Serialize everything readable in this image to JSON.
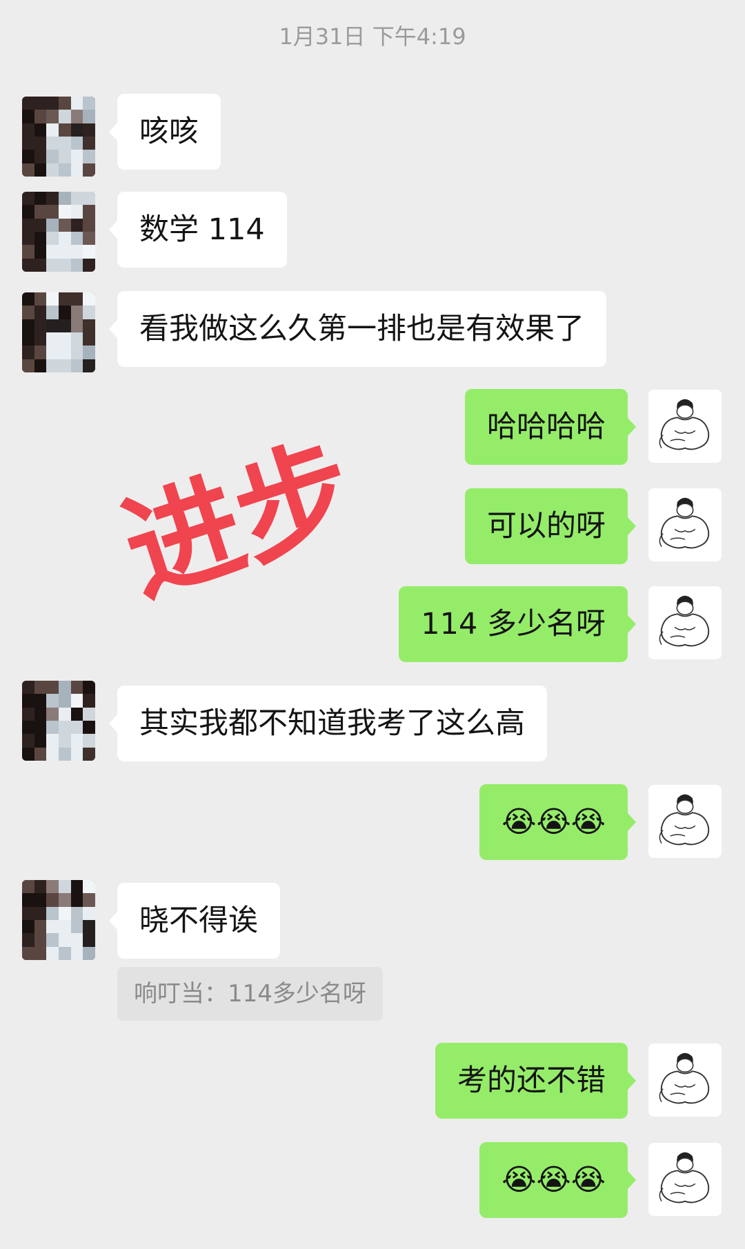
{
  "chat": {
    "timestamp": "1月31日 下午4:19",
    "messages": [
      {
        "side": "in",
        "text": "咳咳"
      },
      {
        "side": "in",
        "text": "数学 114"
      },
      {
        "side": "in",
        "text": "看我做这么久第一排也是有效果了"
      },
      {
        "side": "out",
        "text": "哈哈哈哈"
      },
      {
        "side": "out",
        "text": "可以的呀"
      },
      {
        "side": "out",
        "text": "114 多少名呀"
      },
      {
        "side": "in",
        "text": "其实我都不知道我考了这么高"
      },
      {
        "side": "out",
        "emoji": "😭😭😭",
        "emoji_name": "facepalm-laughing-emoji"
      },
      {
        "side": "in",
        "text": "晓不得诶"
      },
      {
        "side": "out",
        "text": "考的还不错"
      },
      {
        "side": "out",
        "emoji": "😭😭😭",
        "emoji_name": "facepalm-laughing-emoji"
      }
    ],
    "quote": "响叮当：114多少名呀"
  },
  "overlay": {
    "stamp_text": "进步",
    "stamp_color": "#f0444f"
  },
  "colors": {
    "background": "#ededed",
    "incoming_bubble": "#ffffff",
    "outgoing_bubble": "#95ec69",
    "timestamp_text": "#9a9a9a"
  },
  "avatars": {
    "left": "pixelated-user-avatar",
    "right": "muscle-man-avatar"
  }
}
